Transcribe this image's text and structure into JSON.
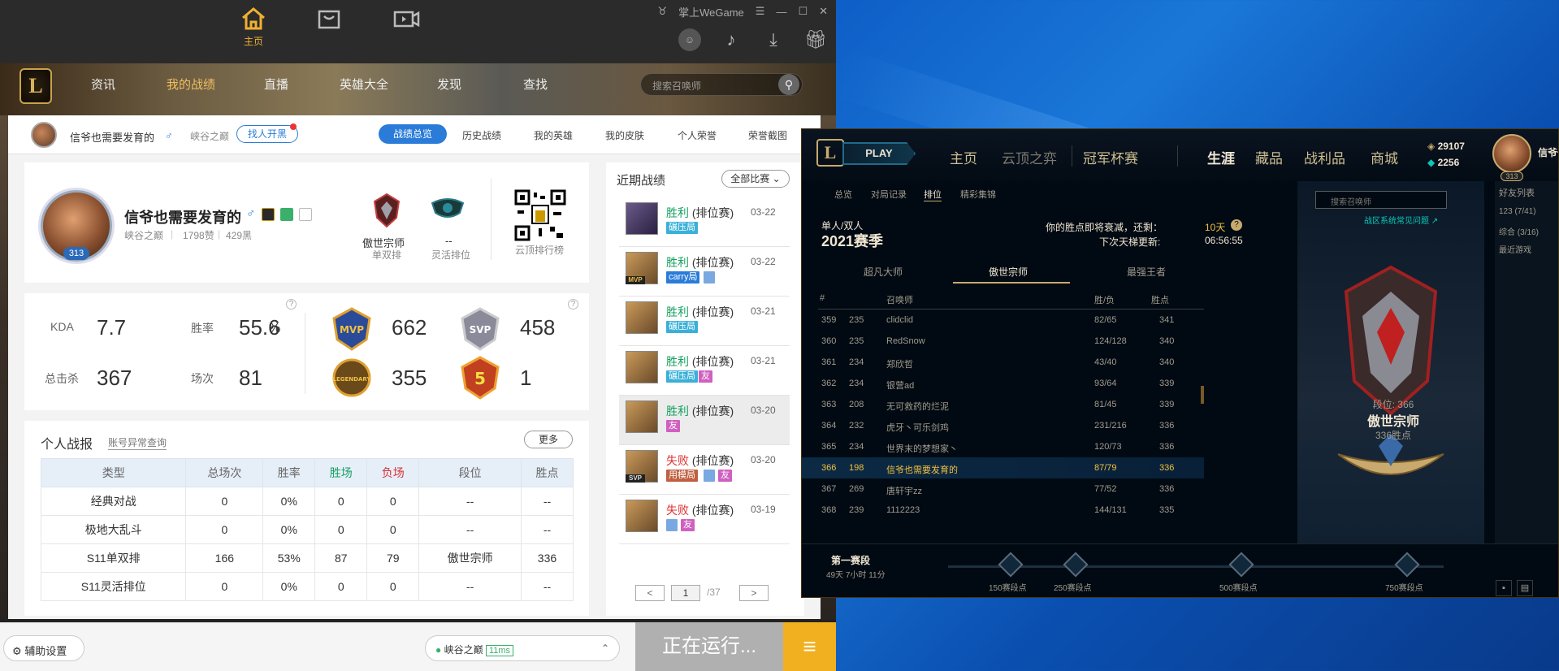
{
  "wegame": {
    "top_tabs": [
      "主页",
      ""
    ],
    "brand": "掌上WeGame",
    "nav": [
      "资讯",
      "我的战绩",
      "直播",
      "英雄大全",
      "发现",
      "查找"
    ],
    "search_placeholder": "搜索召唤师",
    "sub": {
      "name": "信爷也需要发育的",
      "gender": "♂",
      "server": "峡谷之巅",
      "report_btn": "找人开黑",
      "tabs": [
        "战绩总览",
        "历史战绩",
        "我的英雄",
        "我的皮肤",
        "个人荣誉",
        "荣誉截图"
      ]
    },
    "profile": {
      "name": "信爷也需要发育的",
      "server": "峡谷之巅",
      "likes": "1798赞",
      "blacks": "429黑",
      "level": "313",
      "rank1_name": "傲世宗师",
      "rank1_type": "单双排",
      "rank2_name": "--",
      "rank2_type": "灵活排位",
      "qr_label": "云顶排行榜"
    },
    "stats": {
      "kda_label": "KDA",
      "kda": "7.7",
      "winrate_label": "胜率",
      "winrate": "55.6",
      "winrate_pct": "%",
      "kills_label": "总击杀",
      "kills": "367",
      "games_label": "场次",
      "games": "81",
      "mvp": "662",
      "svp": "458",
      "legendary": "355",
      "penta": "1",
      "help": "?"
    },
    "report": {
      "title": "个人战报",
      "anomaly": "账号异常查询",
      "more": "更多",
      "headers": [
        "类型",
        "总场次",
        "胜率",
        "胜场",
        "负场",
        "段位",
        "胜点"
      ],
      "rows": [
        [
          "经典对战",
          "0",
          "0%",
          "0",
          "0",
          "--",
          "--"
        ],
        [
          "极地大乱斗",
          "0",
          "0%",
          "0",
          "0",
          "--",
          "--"
        ],
        [
          "S11单双排",
          "166",
          "53%",
          "87",
          "79",
          "傲世宗师",
          "336"
        ],
        [
          "S11灵活排位",
          "0",
          "0%",
          "0",
          "0",
          "--",
          "--"
        ]
      ]
    },
    "recent": {
      "title": "近期战绩",
      "filter": "全部比赛",
      "matches": [
        {
          "result": "胜利",
          "type": "(排位赛)",
          "date": "03-22",
          "tag": "碾压局",
          "win": true
        },
        {
          "result": "胜利",
          "type": "(排位赛)",
          "date": "03-22",
          "tag": "carry局",
          "win": true
        },
        {
          "result": "胜利",
          "type": "(排位赛)",
          "date": "03-21",
          "tag": "碾压局",
          "win": true
        },
        {
          "result": "胜利",
          "type": "(排位赛)",
          "date": "03-21",
          "tag": "碾压局",
          "win": true
        },
        {
          "result": "胜利",
          "type": "(排位赛)",
          "date": "03-20",
          "tag": "友",
          "win": true
        },
        {
          "result": "失败",
          "type": "(排位赛)",
          "date": "03-20",
          "tag": "用模局",
          "win": false
        },
        {
          "result": "失败",
          "type": "(排位赛)",
          "date": "03-19",
          "tag": "",
          "win": false
        }
      ],
      "badges": {
        "friend": "友",
        "mvp": "MVP",
        "svp": "SVP"
      },
      "page": "1",
      "pages": "/37",
      "prev": "<",
      "next": ">"
    },
    "bottom": {
      "assist": "辅助设置",
      "server": "峡谷之巅",
      "ping": "11ms",
      "running": "正在运行...",
      "menu": "≡"
    }
  },
  "lol": {
    "play": "PLAY",
    "nav": [
      "主页",
      "云顶之弈",
      "冠军杯赛",
      "生涯",
      "藏品",
      "战利品",
      "商城"
    ],
    "rp": "29107",
    "be": "2256",
    "name": "信爷也",
    "sub_tabs": [
      "总览",
      "对局记录",
      "排位",
      "精彩集锦"
    ],
    "queue": "单人/双人",
    "season": "2021赛季",
    "decay_text": "你的胜点即将衰减，还剩：",
    "decay_days": "10天",
    "next_update_label": "下次天梯更新:",
    "next_update": "06:56:55",
    "tiers": [
      "超凡大师",
      "傲世宗师",
      "最强王者"
    ],
    "headers": {
      "num": "#",
      "name": "召唤师",
      "wl": "胜/负",
      "lp": "胜点"
    },
    "ladder": [
      [
        "359",
        "235",
        "clidclid",
        "82/65",
        "341"
      ],
      [
        "360",
        "235",
        "RedSnow",
        "124/128",
        "340"
      ],
      [
        "361",
        "234",
        "郑欣哲",
        "43/40",
        "340"
      ],
      [
        "362",
        "234",
        "银营ad",
        "93/64",
        "339"
      ],
      [
        "363",
        "208",
        "无可救药的烂泥",
        "81/45",
        "339"
      ],
      [
        "364",
        "232",
        "虎牙丶可乐剑鸡",
        "231/216",
        "336"
      ],
      [
        "365",
        "234",
        "世界末的梦想家丶",
        "120/73",
        "336"
      ],
      [
        "366",
        "198",
        "信爷也需要发育的",
        "87/79",
        "336"
      ],
      [
        "367",
        "269",
        "唐轩宇zz",
        "77/52",
        "336"
      ],
      [
        "368",
        "239",
        "1112223",
        "144/131",
        "335"
      ]
    ],
    "search_placeholder": "搜索召唤师",
    "faq": "战区系统常见问题 ↗",
    "rank_lp": "段位: 366",
    "rank_name": "傲世宗师",
    "rank_points": "336胜点",
    "friends": [
      "好友列表",
      "123 (7/41)",
      "综合 (3/16)",
      "最近游戏"
    ],
    "segment": "第一赛段",
    "segment_time": "49天 7小时 11分",
    "milestones": [
      "150赛段点",
      "250赛段点",
      "500赛段点",
      "750赛段点"
    ],
    "level": "313"
  }
}
